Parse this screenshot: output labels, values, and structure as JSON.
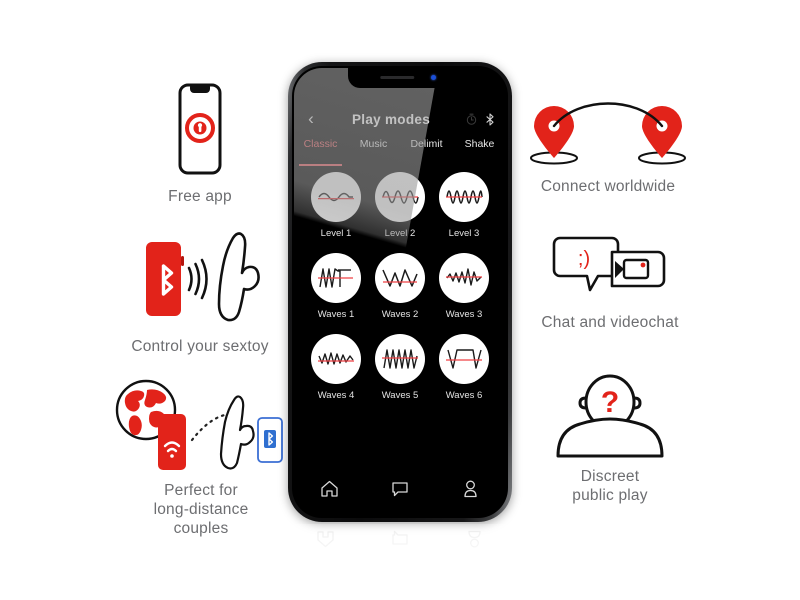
{
  "brand": {
    "red": "#e2231a",
    "accent_pink": "#ef5a60",
    "blue": "#1b4fd8",
    "caption_gray": "#6d6e71"
  },
  "features": {
    "left": [
      {
        "id": "free-app",
        "caption": "Free app",
        "icon": "phone-with-logo-icon"
      },
      {
        "id": "control-sextoy",
        "caption": "Control your sextoy",
        "icon": "phone-bluetooth-toy-icon"
      },
      {
        "id": "long-distance",
        "caption": "Perfect for\nlong-distance\ncouples",
        "icon": "globe-phone-toy-icon"
      }
    ],
    "right": [
      {
        "id": "connect-worldwide",
        "caption": "Connect worldwide",
        "icon": "two-map-pins-arc-icon"
      },
      {
        "id": "chat-videochat",
        "caption": "Chat and videochat",
        "icon": "speech-bubbles-video-icon",
        "emoticon": ";)"
      },
      {
        "id": "discreet-public-play",
        "caption": "Discreet\npublic play",
        "icon": "person-question-icon",
        "glyph": "?"
      }
    ]
  },
  "phone": {
    "nav": {
      "back_label": "‹",
      "title": "Play modes",
      "actions": [
        {
          "name": "timer-icon"
        },
        {
          "name": "bluetooth-icon"
        }
      ]
    },
    "tabs": [
      {
        "label": "Classic",
        "active": true
      },
      {
        "label": "Music",
        "active": false
      },
      {
        "label": "Delimit",
        "active": false
      },
      {
        "label": "Shake",
        "active": false
      }
    ],
    "modes": [
      {
        "label": "Level 1",
        "wave": "sine-low"
      },
      {
        "label": "Level 2",
        "wave": "sine-mid"
      },
      {
        "label": "Level 3",
        "wave": "sine-high"
      },
      {
        "label": "Waves 1",
        "wave": "zigzag-step"
      },
      {
        "label": "Waves 2",
        "wave": "zigzag-peak"
      },
      {
        "label": "Waves 3",
        "wave": "zigzag-dense"
      },
      {
        "label": "Waves 4",
        "wave": "zigzag-small"
      },
      {
        "label": "Waves 5",
        "wave": "spikes-tall"
      },
      {
        "label": "Waves 6",
        "wave": "trapezoid"
      }
    ],
    "tabbar": [
      {
        "name": "home-icon"
      },
      {
        "name": "chat-bubble-icon"
      },
      {
        "name": "profile-icon"
      }
    ]
  }
}
